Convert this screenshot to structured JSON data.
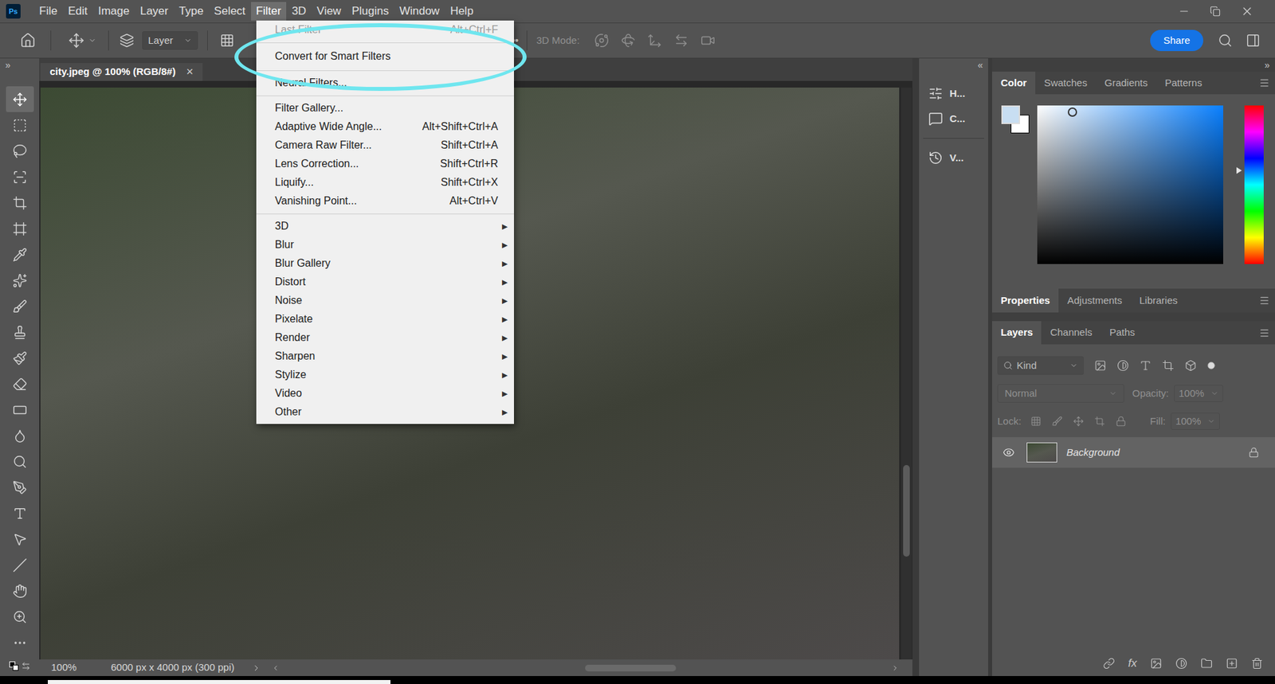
{
  "app": {
    "logo": "Ps"
  },
  "menu_bar": [
    {
      "label": "File",
      "selected": false
    },
    {
      "label": "Edit",
      "selected": false
    },
    {
      "label": "Image",
      "selected": false
    },
    {
      "label": "Layer",
      "selected": false
    },
    {
      "label": "Type",
      "selected": false
    },
    {
      "label": "Select",
      "selected": false
    },
    {
      "label": "Filter",
      "selected": true
    },
    {
      "label": "3D",
      "selected": false
    },
    {
      "label": "View",
      "selected": false
    },
    {
      "label": "Plugins",
      "selected": false
    },
    {
      "label": "Window",
      "selected": false
    },
    {
      "label": "Help",
      "selected": false
    }
  ],
  "options_bar": {
    "auto_select": "Layer",
    "more": "•••",
    "mode_label": "3D Mode:",
    "share": "Share"
  },
  "panel_toggles": {
    "toolbar": "»",
    "mini_dock": "«",
    "right_dock": "»"
  },
  "toolbar": {
    "tools": [
      {
        "selected": true
      },
      {
        "selected": false
      },
      {
        "selected": false
      },
      {
        "selected": false
      },
      {
        "selected": false
      },
      {
        "selected": false
      },
      {
        "selected": false
      },
      {
        "selected": false
      },
      {
        "selected": false
      },
      {
        "selected": false
      },
      {
        "selected": false
      },
      {
        "selected": false
      },
      {
        "selected": false
      },
      {
        "selected": false
      },
      {
        "selected": false
      },
      {
        "selected": false
      },
      {
        "selected": false
      },
      {
        "selected": false
      },
      {
        "selected": false
      },
      {
        "selected": false
      },
      {
        "selected": false
      },
      {
        "selected": false
      }
    ]
  },
  "document": {
    "tab": {
      "title": "city.jpeg @ 100% (RGB/8#)",
      "close": "×",
      "selected": true
    },
    "vertical_scroll": {
      "start": 0.66,
      "size": 0.16
    },
    "horizontal_scroll": {
      "start": 0.5,
      "size": 0.15
    }
  },
  "status_bar": {
    "zoom": "100%",
    "info": "6000 px x 4000 px (300 ppi)"
  },
  "filter_menu": {
    "items": [
      {
        "kind": "item",
        "label": "Last Filter",
        "shortcut": "Alt+Ctrl+F",
        "disabled": true,
        "annotated": false
      },
      {
        "kind": "separator"
      },
      {
        "kind": "item",
        "label": "Convert for Smart Filters",
        "disabled": false,
        "annotated": true
      },
      {
        "kind": "separator"
      },
      {
        "kind": "item",
        "label": "Neural Filters...",
        "disabled": false,
        "annotated": false
      },
      {
        "kind": "separator"
      },
      {
        "kind": "item",
        "label": "Filter Gallery...",
        "disabled": false,
        "annotated": false
      },
      {
        "kind": "item",
        "label": "Adaptive Wide Angle...",
        "shortcut": "Alt+Shift+Ctrl+A",
        "disabled": false,
        "annotated": false
      },
      {
        "kind": "item",
        "label": "Camera Raw Filter...",
        "shortcut": "Shift+Ctrl+A",
        "disabled": false,
        "annotated": false
      },
      {
        "kind": "item",
        "label": "Lens Correction...",
        "shortcut": "Shift+Ctrl+R",
        "disabled": false,
        "annotated": false
      },
      {
        "kind": "item",
        "label": "Liquify...",
        "shortcut": "Shift+Ctrl+X",
        "disabled": false,
        "annotated": false
      },
      {
        "kind": "item",
        "label": "Vanishing Point...",
        "shortcut": "Alt+Ctrl+V",
        "disabled": false,
        "annotated": false
      },
      {
        "kind": "separator"
      },
      {
        "kind": "submenu",
        "label": "3D",
        "arrow": "▶",
        "disabled": false,
        "annotated": false
      },
      {
        "kind": "submenu",
        "label": "Blur",
        "arrow": "▶",
        "disabled": false,
        "annotated": false
      },
      {
        "kind": "submenu",
        "label": "Blur Gallery",
        "arrow": "▶",
        "disabled": false,
        "annotated": false
      },
      {
        "kind": "submenu",
        "label": "Distort",
        "arrow": "▶",
        "disabled": false,
        "annotated": false
      },
      {
        "kind": "submenu",
        "label": "Noise",
        "arrow": "▶",
        "disabled": false,
        "annotated": false
      },
      {
        "kind": "submenu",
        "label": "Pixelate",
        "arrow": "▶",
        "disabled": false,
        "annotated": false
      },
      {
        "kind": "submenu",
        "label": "Render",
        "arrow": "▶",
        "disabled": false,
        "annotated": false
      },
      {
        "kind": "submenu",
        "label": "Sharpen",
        "arrow": "▶",
        "disabled": false,
        "annotated": false
      },
      {
        "kind": "submenu",
        "label": "Stylize",
        "arrow": "▶",
        "disabled": false,
        "annotated": false
      },
      {
        "kind": "submenu",
        "label": "Video",
        "arrow": "▶",
        "disabled": false,
        "annotated": false
      },
      {
        "kind": "submenu",
        "label": "Other",
        "arrow": "▶",
        "disabled": false,
        "annotated": false
      }
    ]
  },
  "mini_dock": [
    {
      "label": "H..."
    },
    {
      "label": "C..."
    },
    {
      "label": "V..."
    }
  ],
  "color_panel": {
    "tabs": [
      {
        "label": "Color",
        "selected": true
      },
      {
        "label": "Swatches",
        "selected": false
      },
      {
        "label": "Gradients",
        "selected": false
      },
      {
        "label": "Patterns",
        "selected": false
      }
    ],
    "foreground": "#c8def2",
    "background": "#ffffff",
    "field_hue": "#0a80ff",
    "saturation": 0.19,
    "brightness": 0.96,
    "hue_level": 0.41
  },
  "properties_tabs": [
    {
      "label": "Properties",
      "selected": true
    },
    {
      "label": "Adjustments",
      "selected": false
    },
    {
      "label": "Libraries",
      "selected": false
    }
  ],
  "layers_panel": {
    "tabs": [
      {
        "label": "Layers",
        "selected": true
      },
      {
        "label": "Channels",
        "selected": false
      },
      {
        "label": "Paths",
        "selected": false
      }
    ],
    "filter_placeholder": "Kind",
    "blend_mode": {
      "value": "Normal",
      "disabled": true
    },
    "opacity": {
      "label": "Opacity:",
      "value": "100%",
      "disabled": true
    },
    "lock_label": "Lock:",
    "fill": {
      "label": "Fill:",
      "value": "100%",
      "disabled": true
    },
    "layers": [
      {
        "name": "Background",
        "visible": true,
        "locked": true,
        "selected": true
      }
    ],
    "footer": {
      "fx": "fx"
    }
  }
}
